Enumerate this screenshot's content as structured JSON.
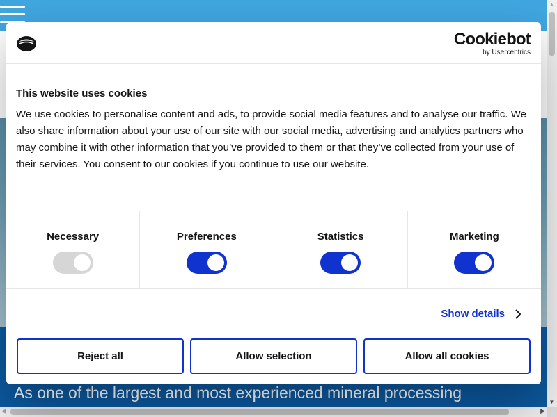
{
  "background": {
    "intro_text": "As one of the largest and most experienced mineral processing"
  },
  "dialog": {
    "brand_name": "Cookiebot",
    "brand_by": "by Usercentrics",
    "title": "This website uses cookies",
    "body": "We use cookies to personalise content and ads, to provide social media features and to analyse our traffic. We also share information about your use of our site with our social media, advertising and analytics partners who may combine it with other information that you’ve provided to them or that they’ve collected from your use of their services. You consent to our cookies if you continue to use our website.",
    "toggles": [
      {
        "label": "Necessary",
        "enabled": true,
        "disabled": true
      },
      {
        "label": "Preferences",
        "enabled": true,
        "disabled": false
      },
      {
        "label": "Statistics",
        "enabled": true,
        "disabled": false
      },
      {
        "label": "Marketing",
        "enabled": true,
        "disabled": false
      }
    ],
    "show_details": "Show details",
    "buttons": {
      "reject": "Reject all",
      "allow_selection": "Allow selection",
      "allow_all": "Allow all cookies"
    }
  },
  "colors": {
    "accent": "#1032cf",
    "header_bg": "#41a6e0",
    "band_bg": "#0c5aa1"
  },
  "icons": [
    "hamburger-menu-icon",
    "cookie-logo-icon",
    "chevron-right-icon"
  ]
}
